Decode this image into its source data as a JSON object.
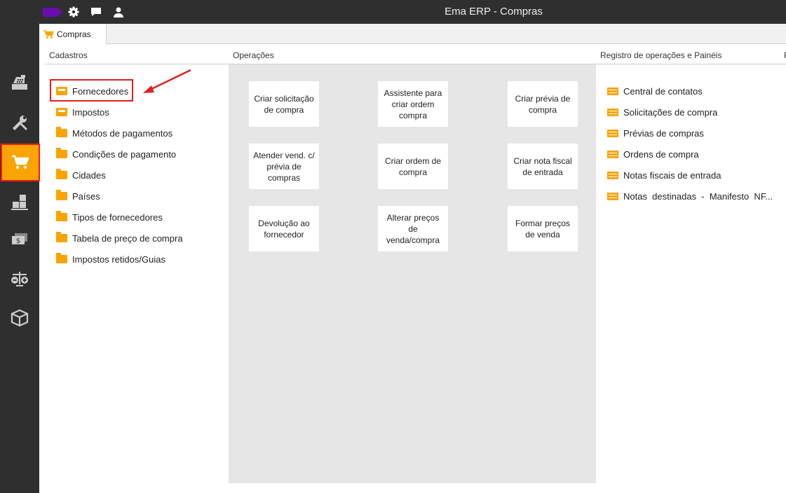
{
  "window": {
    "title": "Ema ERP - Compras"
  },
  "tab": {
    "label": "Compras"
  },
  "sections": {
    "cadastros": "Cadastros",
    "operacoes": "Operações",
    "registro": "Registro de operações e Painéis",
    "cut": "P"
  },
  "cadastros": [
    {
      "label": "Fornecedores",
      "icon": "tray-icon"
    },
    {
      "label": "Impostos",
      "icon": "tray-icon"
    },
    {
      "label": "Métodos de pagamentos",
      "icon": "folder-icon"
    },
    {
      "label": "Condições de pagamento",
      "icon": "folder-icon"
    },
    {
      "label": "Cidades",
      "icon": "folder-icon"
    },
    {
      "label": "Países",
      "icon": "folder-icon"
    },
    {
      "label": "Tipos de fornecedores",
      "icon": "folder-icon"
    },
    {
      "label": "Tabela de preço de compra",
      "icon": "folder-icon"
    },
    {
      "label": "Impostos retidos/Guias",
      "icon": "folder-icon"
    }
  ],
  "operacoes": [
    "Criar solicitação de compra",
    "Assistente para criar ordem compra",
    "Criar prévia de compra",
    "Atender vend. c/ prévia de compras",
    "Criar ordem de compra",
    "Criar nota fiscal de entrada",
    "Devolução ao fornecedor",
    "Alterar preços de venda/compra",
    "Formar preços de venda"
  ],
  "registro": [
    "Central de contatos",
    "Solicitações de compra",
    "Prévias de compras",
    "Ordens de compra",
    "Notas fiscais de entrada",
    "Notas  destinadas  -  Manifesto  NF..."
  ],
  "colors": {
    "accent": "#f9a400",
    "dark": "#2f2f2f",
    "highlight": "#e02020",
    "tag": "#6a0dad"
  }
}
